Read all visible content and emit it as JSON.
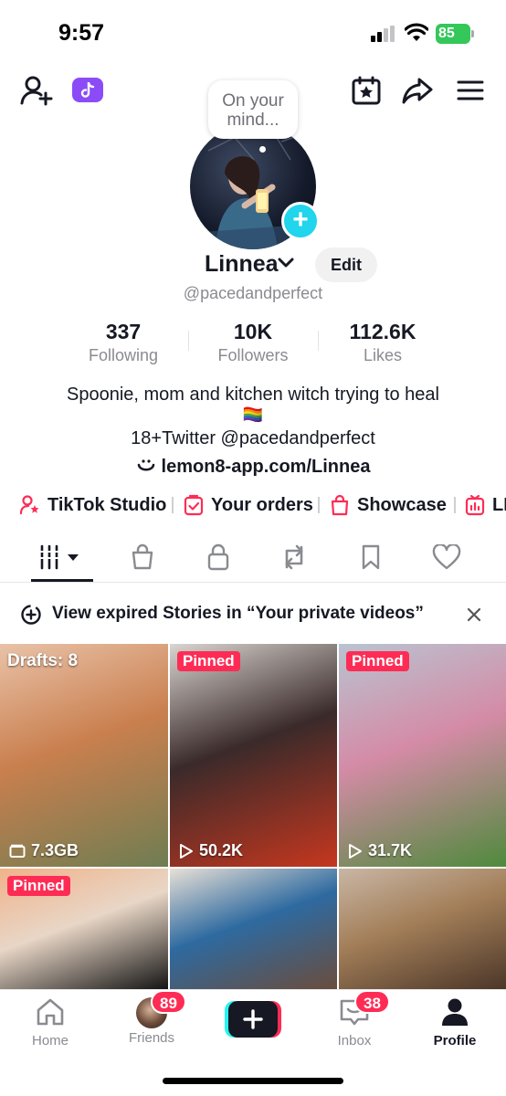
{
  "status_bar": {
    "time": "9:57",
    "battery": "85"
  },
  "profile": {
    "bubble_text": "On your mind...",
    "name": "Linnea",
    "edit_label": "Edit",
    "handle": "@pacedandperfect",
    "stats": [
      {
        "value": "337",
        "label": "Following"
      },
      {
        "value": "10K",
        "label": "Followers"
      },
      {
        "value": "112.6K",
        "label": "Likes"
      }
    ],
    "bio_line1": "Spoonie, mom and kitchen witch trying to heal",
    "bio_flag": "🏳️‍🌈",
    "bio_line2": "18+Twitter @pacedandperfect",
    "link": "lemon8-app.com/Linnea"
  },
  "shortcuts": [
    {
      "label": "TikTok Studio",
      "icon": "person-star-icon"
    },
    {
      "label": "Your orders",
      "icon": "order-check-icon"
    },
    {
      "label": "Showcase",
      "icon": "shopping-bag-icon"
    },
    {
      "label": "LI",
      "icon": "analytics-icon"
    }
  ],
  "tabs": [
    "videos-grid-icon",
    "shop-bag-icon",
    "lock-icon",
    "repost-icon",
    "bookmark-icon",
    "heart-icon"
  ],
  "stories_banner": {
    "text": "View expired Stories in “Your private videos”"
  },
  "grid": [
    {
      "overlay": "Drafts: 8",
      "meta": "7.3GB",
      "meta_icon": "folder-icon",
      "colors": [
        "#e9c2a8",
        "#6f7d52",
        "#c97f4e"
      ]
    },
    {
      "overlay": "Pinned",
      "meta": "50.2K",
      "meta_icon": "play-icon",
      "colors": [
        "#d9d5d0",
        "#c5371f",
        "#3a2a2a"
      ]
    },
    {
      "overlay": "Pinned",
      "meta": "31.7K",
      "meta_icon": "play-icon",
      "colors": [
        "#b9c4d1",
        "#4f8a3c",
        "#d48ba6"
      ]
    },
    {
      "overlay": "Pinned",
      "meta": "",
      "meta_icon": "",
      "colors": [
        "#f0b38a",
        "#111111",
        "#e8d6c6"
      ]
    },
    {
      "overlay": "",
      "meta": "",
      "meta_icon": "",
      "colors": [
        "#e8e0d6",
        "#6b4c3b",
        "#2e6aa0"
      ]
    },
    {
      "overlay": "",
      "meta": "",
      "meta_icon": "",
      "colors": [
        "#c9b6a5",
        "#4a3528",
        "#a27e58"
      ]
    }
  ],
  "bottom_nav": {
    "home": "Home",
    "friends": "Friends",
    "friends_badge": "89",
    "inbox": "Inbox",
    "inbox_badge": "38",
    "profile": "Profile"
  },
  "colors": {
    "accent": "#fe2c55",
    "cyan": "#20d5ec",
    "text": "#161823",
    "muted": "#8a8b91"
  }
}
